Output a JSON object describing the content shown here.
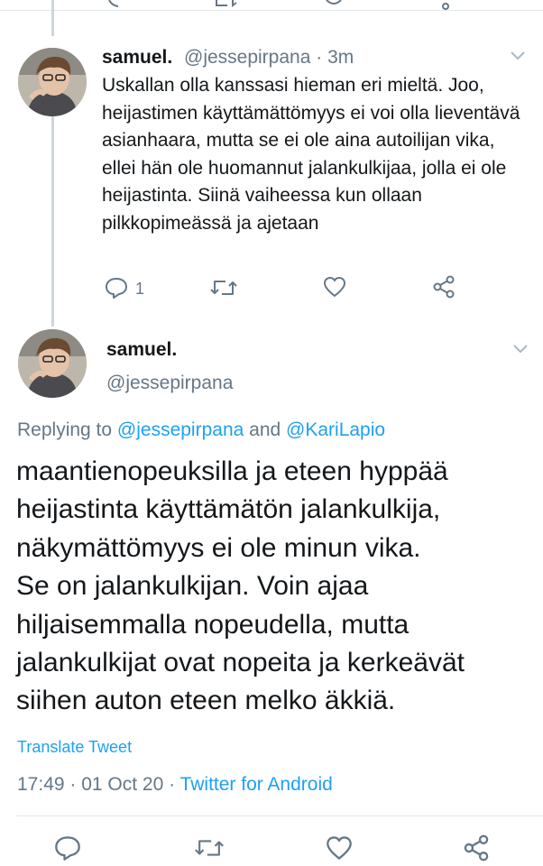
{
  "tweet1": {
    "name": "samuel.",
    "handle": "@jessepirpana",
    "time": "3m",
    "separator": "·",
    "text": "Uskallan olla kanssasi hieman eri mieltä. Joo, heijastimen käyttämättömyys ei voi olla lieventävä asianhaara, mutta se ei ole aina autoilijan vika, ellei hän ole huomannut jalankulkijaa, jolla ei ole heijastinta. Siinä vaiheessa kun ollaan pilkkopimeässä ja ajetaan",
    "reply_count": "1",
    "icons": [
      "reply-icon",
      "retweet-icon",
      "like-icon",
      "share-icon",
      "chevron-down-icon"
    ]
  },
  "tweet2": {
    "name": "samuel.",
    "handle": "@jessepirpana",
    "replying_prefix": "Replying to ",
    "replying_user1": "@jessepirpana",
    "replying_and": " and ",
    "replying_user2": "@KariLapio",
    "lines": [
      "maantienopeuksilla ja eteen hyppää",
      "heijastinta käyttämätön jalankulkija,",
      "näkymättömyys ei ole minun vika.",
      "Se on jalankulkijan. Voin ajaa",
      "hiljaisemmalla nopeudella, mutta",
      "jalankulkijat ovat nopeita ja kerkeävät",
      "siihen auton eteen melko äkkiä."
    ],
    "translate": "Translate Tweet",
    "timestamp": "17:49 · 01 Oct 20 · ",
    "client": "Twitter for Android"
  },
  "colors": {
    "accent": "#1da1f2",
    "secondary_text": "#657786",
    "text": "#14171a",
    "divider": "#e1e8ed"
  }
}
